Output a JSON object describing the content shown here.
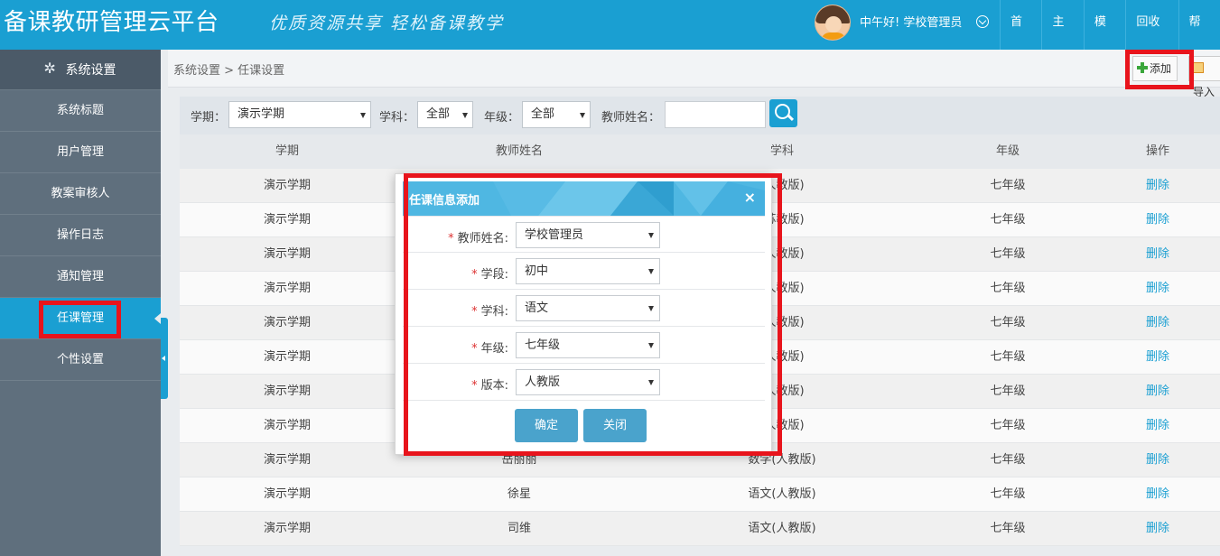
{
  "header": {
    "app_title": "备课教研管理云平台",
    "slogan": "优质资源共享  轻松备课教学",
    "greeting": "中午好! 学校管理员",
    "nav": [
      "首页",
      "主页",
      "模板",
      "回收站",
      "帮助"
    ]
  },
  "sidebar": {
    "title": "系统设置",
    "items": [
      {
        "label": "系统标题"
      },
      {
        "label": "用户管理"
      },
      {
        "label": "教案审核人"
      },
      {
        "label": "操作日志"
      },
      {
        "label": "通知管理"
      },
      {
        "label": "任课管理",
        "active": true
      },
      {
        "label": "个性设置"
      }
    ]
  },
  "breadcrumb": "系统设置 > 任课设置",
  "toolbar": {
    "add_label": "添加",
    "import_label": "导入"
  },
  "filters": {
    "term_label": "学期：",
    "term_value": "演示学期",
    "subject_label": "学科：",
    "subject_value": "全部",
    "grade_label": "年级：",
    "grade_value": "全部",
    "teacher_label": "教师姓名：",
    "teacher_value": ""
  },
  "table": {
    "headers": [
      "学期",
      "教师姓名",
      "学科",
      "年级",
      "操作"
    ],
    "rows": [
      {
        "term": "演示学期",
        "teacher": "",
        "subject": "(人教版)",
        "grade": "七年级",
        "action": "删除"
      },
      {
        "term": "演示学期",
        "teacher": "",
        "subject": "(苏教版)",
        "grade": "七年级",
        "action": "删除"
      },
      {
        "term": "演示学期",
        "teacher": "",
        "subject": "(人教版)",
        "grade": "七年级",
        "action": "删除"
      },
      {
        "term": "演示学期",
        "teacher": "",
        "subject": "(人教版)",
        "grade": "七年级",
        "action": "删除"
      },
      {
        "term": "演示学期",
        "teacher": "",
        "subject": "(人教版)",
        "grade": "七年级",
        "action": "删除"
      },
      {
        "term": "演示学期",
        "teacher": "",
        "subject": "(人教版)",
        "grade": "七年级",
        "action": "删除"
      },
      {
        "term": "演示学期",
        "teacher": "",
        "subject": "(人教版)",
        "grade": "七年级",
        "action": "删除"
      },
      {
        "term": "演示学期",
        "teacher": "",
        "subject": "(人教版)",
        "grade": "七年级",
        "action": "删除"
      },
      {
        "term": "演示学期",
        "teacher": "岳丽丽",
        "subject": "数学(人教版)",
        "grade": "七年级",
        "action": "删除"
      },
      {
        "term": "演示学期",
        "teacher": "徐星",
        "subject": "语文(人教版)",
        "grade": "七年级",
        "action": "删除"
      },
      {
        "term": "演示学期",
        "teacher": "司维",
        "subject": "语文(人教版)",
        "grade": "七年级",
        "action": "删除"
      }
    ]
  },
  "modal": {
    "title": "任课信息添加",
    "close": "×",
    "fields": [
      {
        "label": "教师姓名:",
        "value": "学校管理员"
      },
      {
        "label": "学段:",
        "value": "初中"
      },
      {
        "label": "学科:",
        "value": "语文"
      },
      {
        "label": "年级:",
        "value": "七年级"
      },
      {
        "label": "版本:",
        "value": "人教版"
      }
    ],
    "required_mark": "*",
    "confirm_label": "确定",
    "close_label": "关闭"
  },
  "colors": {
    "brand": "#1a9fd2",
    "highlight": "#e8141c",
    "sidebar": "#5f6f7d",
    "delete_link": "#1a9fd2"
  }
}
